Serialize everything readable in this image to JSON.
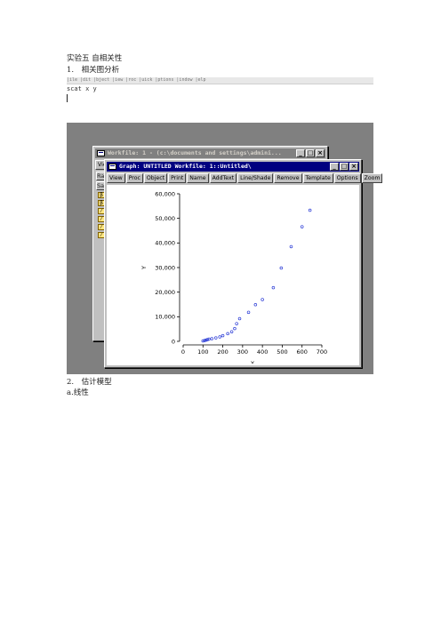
{
  "document": {
    "heading": "实验五 自相关性",
    "section1": "1.　相关图分析",
    "command_strip": "|ile  |dit  |bject  |iew  |roc  |uick  |ptions  |indow  |elp",
    "command": "scat x y",
    "section2": "2.　估计模型",
    "subsection_a": "a.线性"
  },
  "workfile_window": {
    "title": "Workfile: 1 - (c:\\documents and settings\\admini...",
    "toolbar_visible": "View",
    "side_tabs": [
      "Ra",
      "Sa"
    ],
    "object_icons": [
      "β",
      "β",
      "⁄",
      "⁄",
      "⁄",
      "⁄"
    ]
  },
  "graph_window": {
    "title": "Graph: UNTITLED    Workfile: 1::Untitled\\",
    "toolbar": [
      "View",
      "Proc",
      "Object",
      "Print",
      "Name",
      "AddText",
      "Line/Shade",
      "Remove",
      "Template",
      "Options",
      "Zoom"
    ]
  },
  "window_controls": {
    "minimize": "_",
    "maximize": "□",
    "close": "×"
  },
  "colors": {
    "marker": "#2a3bd6",
    "title_active": "#000080",
    "title_inactive": "#808080",
    "desktop": "#808080"
  },
  "chart_data": {
    "type": "scatter",
    "xlabel": "X",
    "ylabel": "Y",
    "xlim": [
      0,
      700
    ],
    "ylim": [
      0,
      60000
    ],
    "x_ticks": [
      0,
      100,
      200,
      300,
      400,
      500,
      600,
      700
    ],
    "y_ticks": [
      0,
      10000,
      20000,
      30000,
      40000,
      50000,
      60000
    ],
    "x_tick_labels": [
      "0",
      "100",
      "200",
      "300",
      "400",
      "500",
      "600",
      "700"
    ],
    "y_tick_labels": [
      "0",
      "10,000",
      "20,000",
      "30,000",
      "40,000",
      "50,000",
      "60,000"
    ],
    "grid": false,
    "marker": "open-circle",
    "x": [
      100,
      108,
      115,
      122,
      130,
      145,
      165,
      185,
      200,
      225,
      245,
      260,
      270,
      285,
      330,
      365,
      400,
      455,
      495,
      545,
      600,
      640
    ],
    "y": [
      200,
      300,
      500,
      700,
      900,
      1100,
      1400,
      1800,
      2300,
      3100,
      3900,
      5200,
      7200,
      9200,
      11800,
      14900,
      17000,
      21800,
      29800,
      38500,
      46600,
      53300
    ]
  }
}
